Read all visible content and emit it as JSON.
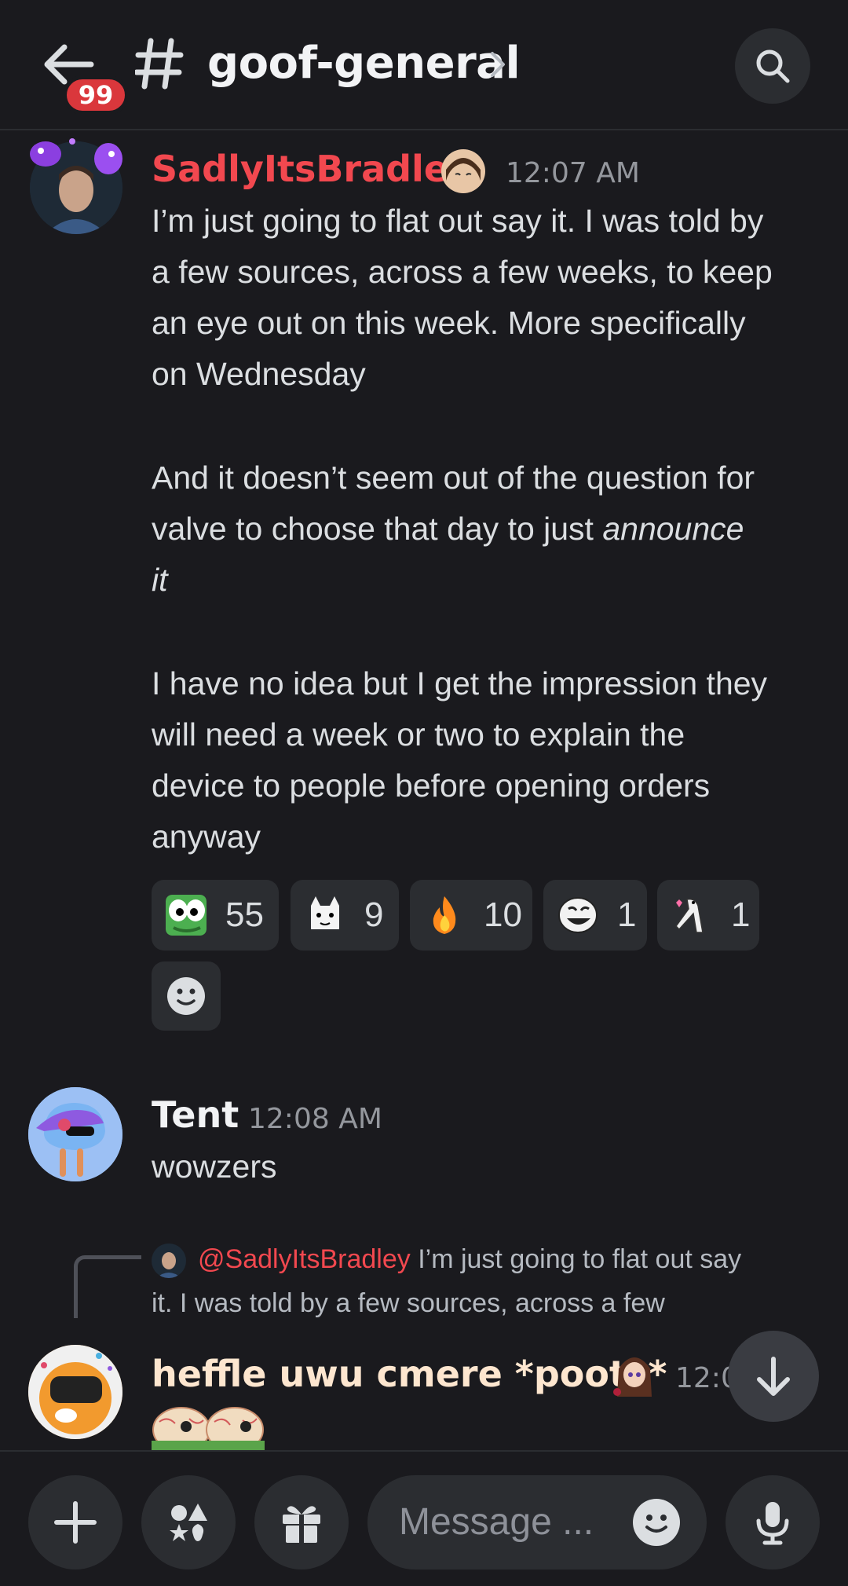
{
  "header": {
    "unread_badge": "99",
    "channel_name": "goof-general"
  },
  "messages": [
    {
      "author": "SadlyItsBradley",
      "time": "12:07 AM",
      "author_color": "#f2484f",
      "lines": [
        "I’m just going to flat out say it. I was told by",
        "a few sources, across a few weeks, to keep",
        "an eye out on this week. More specifically",
        "on Wednesday",
        "And it doesn’t seem out of the question for",
        "valve to choose that day to just ",
        "announce",
        "it",
        "I have no idea but I get the impression they",
        "will need a week or two to explain the",
        "device to people before opening orders",
        "anyway"
      ],
      "reactions": [
        {
          "emoji": "peepo-emoji",
          "count": "55"
        },
        {
          "emoji": "cat-emoji",
          "count": "9"
        },
        {
          "emoji": "fire-emoji",
          "count": "10"
        },
        {
          "emoji": "trollface-emoji",
          "count": "1"
        },
        {
          "emoji": "dog-emoji",
          "count": "1"
        }
      ]
    },
    {
      "author": "Tent",
      "time": "12:08 AM",
      "author_color": "#f2f3f5",
      "text": "wowzers"
    },
    {
      "reply_mention": "@SadlyItsBradley",
      "reply_line1": " I’m just going to flat out say",
      "reply_line2": "it. I was told by a few sources, across a few",
      "author": "heffle uwu cmere *poots*",
      "time": "12:0",
      "author_color": "#fde6cf"
    }
  ],
  "composer": {
    "placeholder": "Message ..."
  },
  "colors": {
    "background": "#1a1a1e",
    "surface": "#2b2d31",
    "badge_red": "#da373c",
    "mention_red": "#f2484f"
  }
}
